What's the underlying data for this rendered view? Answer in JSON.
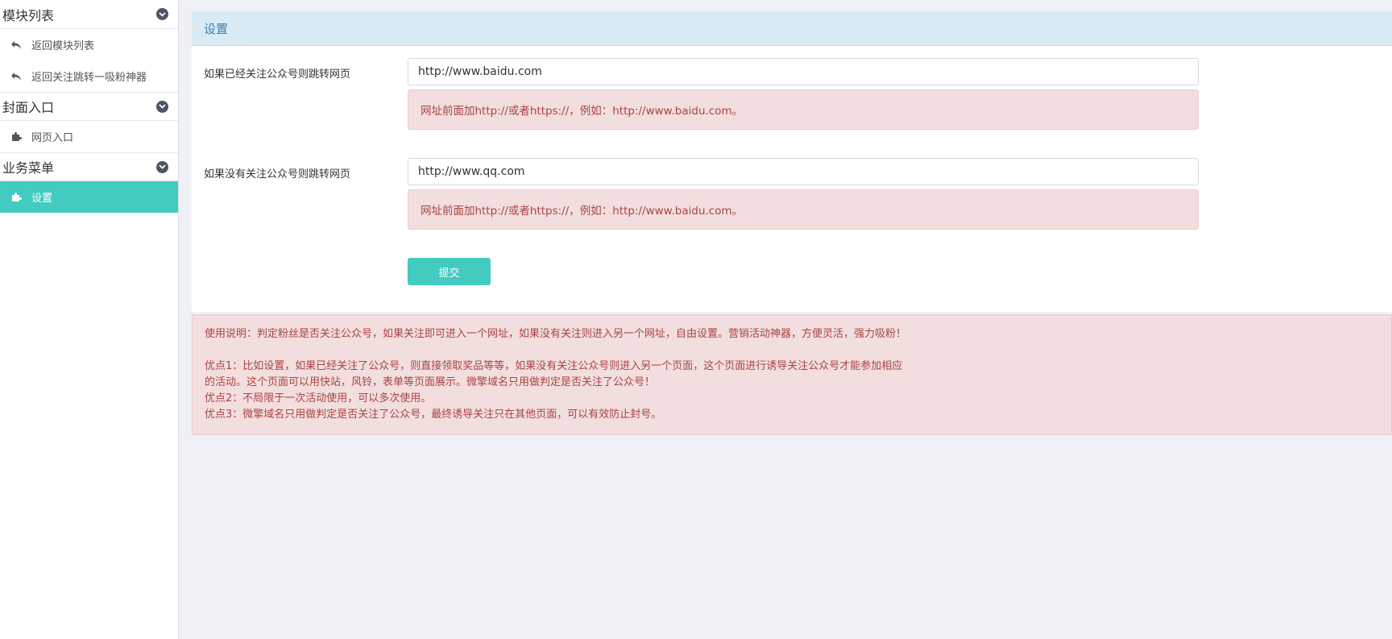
{
  "sidebar": {
    "sections": [
      {
        "title": "模块列表",
        "items": [
          {
            "label": "返回模块列表",
            "icon": "reply-icon"
          },
          {
            "label": "返回关注跳转一吸粉神器",
            "icon": "reply-icon"
          }
        ]
      },
      {
        "title": "封面入口",
        "items": [
          {
            "label": "网页入口",
            "icon": "puzzle-icon"
          }
        ]
      },
      {
        "title": "业务菜单",
        "items": [
          {
            "label": "设置",
            "icon": "puzzle-icon",
            "active": true
          }
        ]
      }
    ]
  },
  "panel": {
    "title": "设置",
    "fields": [
      {
        "label": "如果已经关注公众号则跳转网页",
        "value": "http://www.baidu.com",
        "help": "网址前面加http://或者https://，例如：http://www.baidu.com。"
      },
      {
        "label": "如果没有关注公众号则跳转网页",
        "value": "http://www.qq.com",
        "help": "网址前面加http://或者https://，例如：http://www.baidu.com。"
      }
    ],
    "submit_label": "提交"
  },
  "notice": {
    "line1": "使用说明：判定粉丝是否关注公众号，如果关注即可进入一个网址，如果没有关注则进入另一个网址，自由设置。营销活动神器，方便灵活，强力吸粉！",
    "line2": "优点1：比如设置，如果已经关注了公众号，则直接领取奖品等等，如果没有关注公众号则进入另一个页面，这个页面进行诱导关注公众号才能参加相应",
    "line3": "的活动。这个页面可以用快站，风铃，表单等页面展示。微擎域名只用做判定是否关注了公众号！",
    "line4": "优点2：不局限于一次活动使用，可以多次使用。",
    "line5": "优点3：微擎域名只用做判定是否关注了公众号，最终诱导关注只在其他页面，可以有效防止封号。"
  },
  "colors": {
    "accent": "#43cbc1",
    "panel_header_bg": "#d8ebf4",
    "panel_header_text": "#3b7fae",
    "help_bg": "#f2dede",
    "help_text": "#a94442",
    "page_bg": "#eff1f6"
  }
}
